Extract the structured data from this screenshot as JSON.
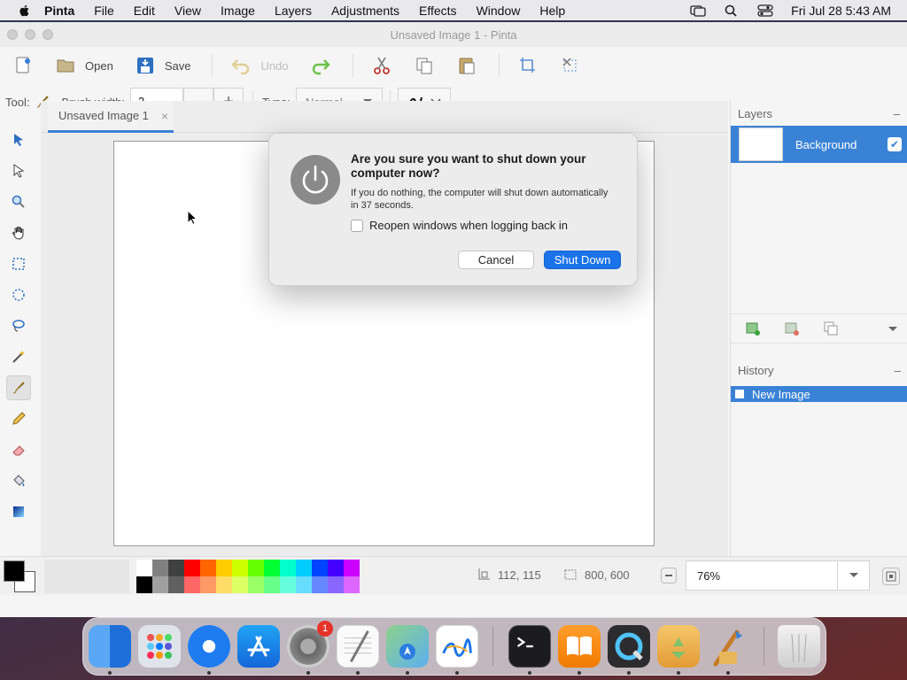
{
  "menubar": {
    "app_name": "Pinta",
    "items": [
      "File",
      "Edit",
      "View",
      "Image",
      "Layers",
      "Adjustments",
      "Effects",
      "Window",
      "Help"
    ],
    "clock": "Fri Jul 28  5:43 AM"
  },
  "window": {
    "title": "Unsaved Image 1 - Pinta"
  },
  "toolbar": {
    "open_label": "Open",
    "save_label": "Save",
    "undo_label": "Undo"
  },
  "tool_options": {
    "tool_label": "Tool:",
    "brush_width_label": "Brush width:",
    "brush_width_value": "2",
    "type_label": "Type:",
    "type_value": "Normal",
    "minus": "—",
    "plus": "+"
  },
  "document_tab": {
    "label": "Unsaved Image 1",
    "close": "×"
  },
  "layers_panel": {
    "title": "Layers",
    "collapse": "–",
    "layer_name": "Background",
    "check": "✔"
  },
  "history_panel": {
    "title": "History",
    "collapse": "–",
    "item": "New Image"
  },
  "status": {
    "cursor_position": "112, 115",
    "image_size": "800, 600",
    "zoom": "76%"
  },
  "dialog": {
    "title": "Are you sure you want to shut down your computer now?",
    "message": "If you do nothing, the computer will shut down automatically in 37 seconds.",
    "checkbox_label": "Reopen windows when logging back in",
    "cancel_label": "Cancel",
    "confirm_label": "Shut Down"
  },
  "dock": {
    "settings_badge": "1"
  },
  "colors": {
    "accent": "#3a82d6",
    "primary_button": "#1a73e8"
  },
  "palette_top": [
    "#ffffff",
    "#808080",
    "#404040",
    "#ff0000",
    "#ff6600",
    "#ffcc00",
    "#ccff00",
    "#66ff00",
    "#00ff33",
    "#00ffcc",
    "#00ccff",
    "#0044ff",
    "#4400ff",
    "#cc00ff"
  ],
  "palette_bottom": [
    "#000000",
    "#a0a0a0",
    "#606060",
    "#ff6666",
    "#ff9966",
    "#ffdd66",
    "#ddff66",
    "#99ff66",
    "#66ff88",
    "#66ffdd",
    "#66ddff",
    "#6688ff",
    "#8866ff",
    "#dd66ff"
  ]
}
